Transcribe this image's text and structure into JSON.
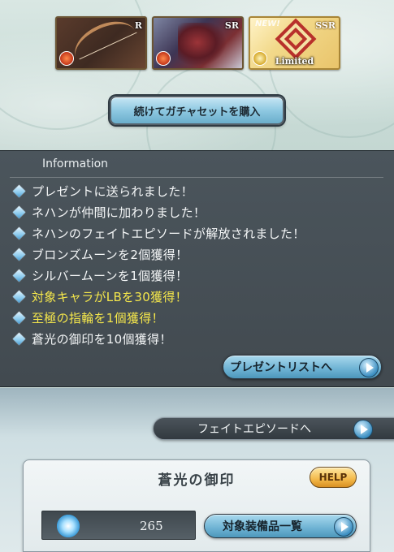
{
  "gacha_results": [
    {
      "rarity": "R",
      "element": "fire",
      "art": "bow-weapon"
    },
    {
      "rarity": "SR",
      "element": "fire",
      "art": "dragon-summon"
    },
    {
      "rarity": "SSR",
      "element": "light",
      "art": "knot-emblem",
      "tag": "NEW!",
      "label": "Limited"
    }
  ],
  "gacha_button": {
    "label": "続けてガチャセットを購入"
  },
  "information": {
    "title": "Information",
    "items": [
      {
        "text": "プレゼントに送られました！",
        "highlight": false
      },
      {
        "text": "ネハンが仲間に加わりました！",
        "highlight": false
      },
      {
        "text": "ネハンのフェイトエピソードが解放されました！",
        "highlight": false
      },
      {
        "text": "ブロンズムーンを2個獲得！",
        "highlight": false
      },
      {
        "text": "シルバームーンを1個獲得！",
        "highlight": false
      },
      {
        "text": "対象キャラがLBを30獲得！",
        "highlight": true
      },
      {
        "text": "至極の指輪を1個獲得！",
        "highlight": true
      },
      {
        "text": "蒼光の御印を10個獲得！",
        "highlight": false
      }
    ],
    "present_list_button": "プレゼントリストへ"
  },
  "fate_episode_button": "フェイトエピソードへ",
  "seal_panel": {
    "title": "蒼光の御印",
    "help_label": "HELP",
    "count": "265",
    "equip_list_button": "対象装備品一覧"
  },
  "colors": {
    "highlight_text": "#f5e74b",
    "button_blue": "#6db2d3",
    "help_gold": "#f3b94a"
  }
}
